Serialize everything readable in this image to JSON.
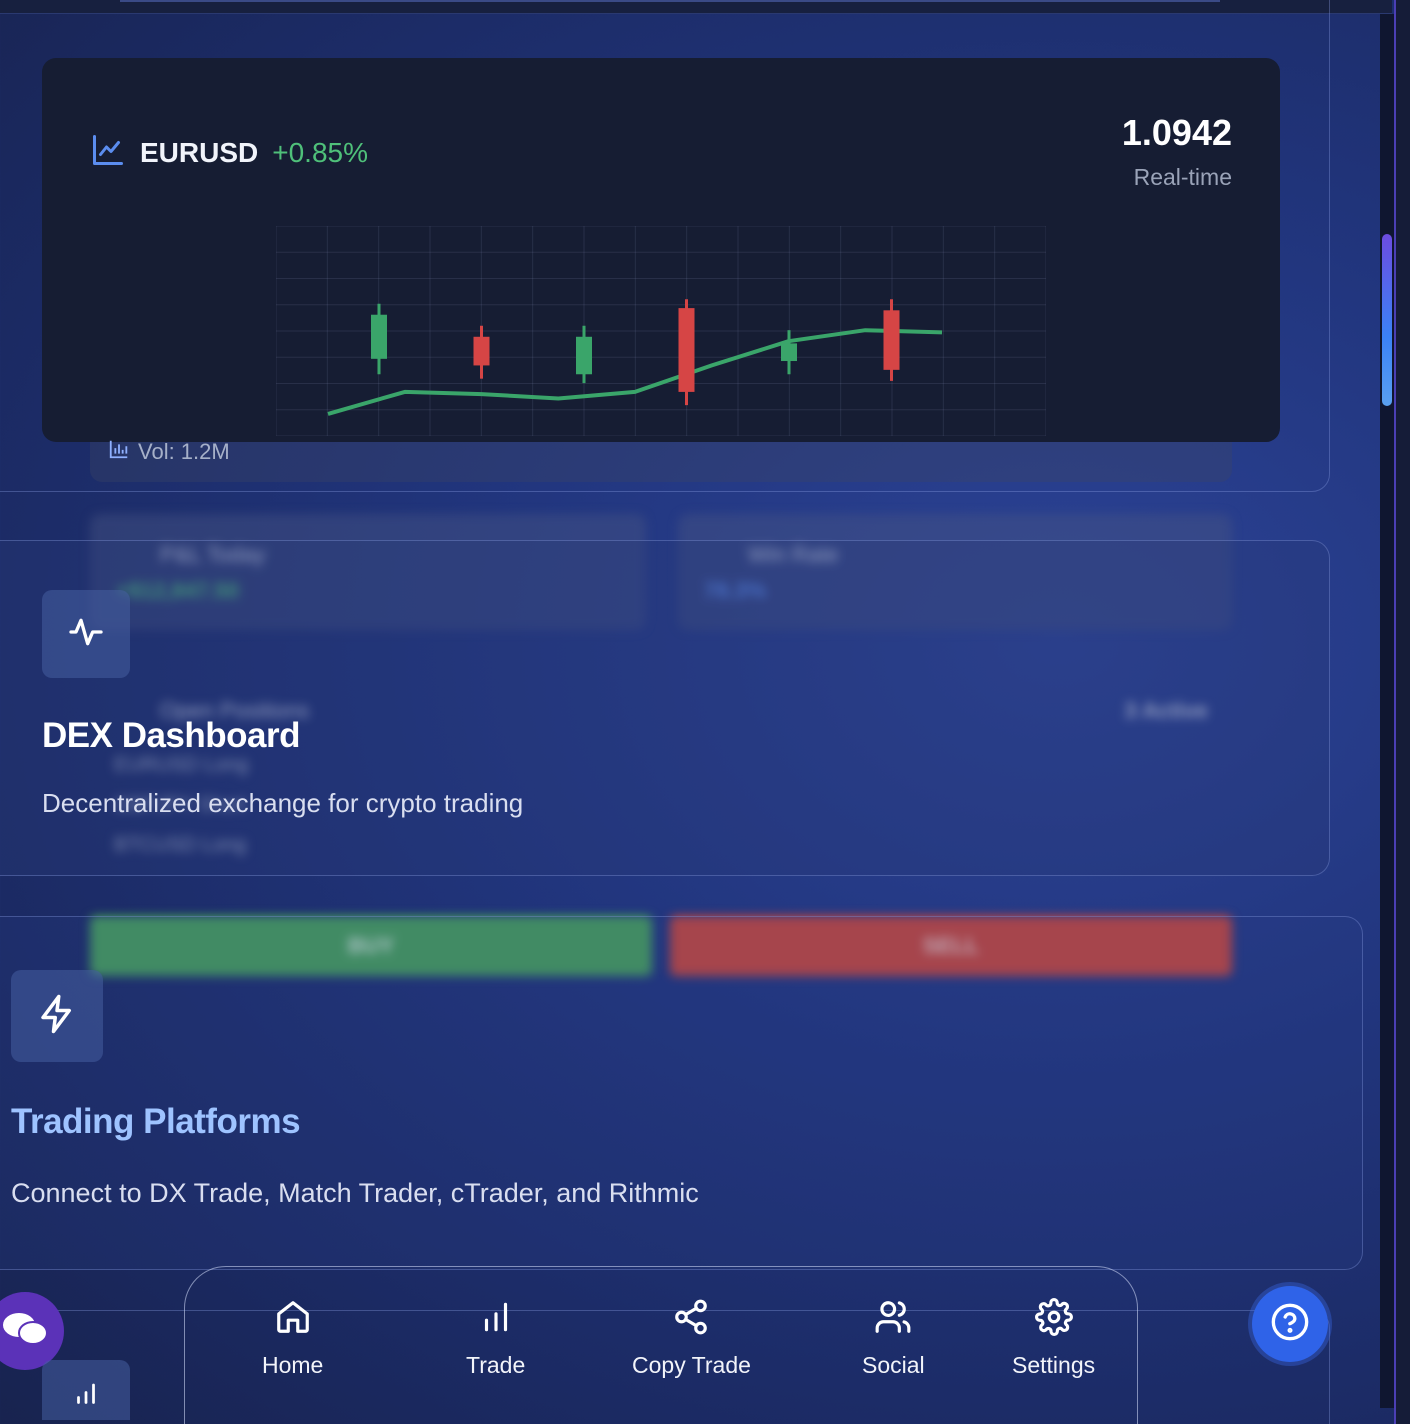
{
  "ticker": {
    "pair": "EURUSD",
    "change": "+0.85%",
    "price": "1.0942",
    "price_caption": "Real-time",
    "volume": "Vol: 1.2M"
  },
  "chart_data": {
    "type": "candlestick",
    "candles": [
      {
        "open": 0.35,
        "close": 0.55,
        "high": 0.6,
        "low": 0.28,
        "direction": "up"
      },
      {
        "open": 0.45,
        "close": 0.32,
        "high": 0.5,
        "low": 0.26,
        "direction": "down"
      },
      {
        "open": 0.28,
        "close": 0.45,
        "high": 0.5,
        "low": 0.24,
        "direction": "up"
      },
      {
        "open": 0.58,
        "close": 0.2,
        "high": 0.62,
        "low": 0.14,
        "direction": "down"
      },
      {
        "open": 0.34,
        "close": 0.42,
        "high": 0.48,
        "low": 0.28,
        "direction": "up"
      },
      {
        "open": 0.57,
        "close": 0.3,
        "high": 0.62,
        "low": 0.25,
        "direction": "down"
      }
    ],
    "trend_line": [
      0.1,
      0.2,
      0.19,
      0.17,
      0.2,
      0.32,
      0.43,
      0.48,
      0.47
    ],
    "colors": {
      "up": "#3aa56a",
      "down": "#d64545",
      "line": "#3aa56a"
    }
  },
  "background_blurred": {
    "pnl_label": "P&L Today",
    "pnl_value": "+$12,847.50",
    "win_label": "Win Rate",
    "win_value": "78.3%",
    "positions_label": "Open Positions",
    "positions_count": "3 Active",
    "positions": [
      "EURUSD Long",
      "GBPJPY Short",
      "BTCUSD Long"
    ],
    "buy_label": "BUY",
    "sell_label": "SELL"
  },
  "features": [
    {
      "title": "DEX Dashboard",
      "description": "Decentralized exchange for crypto trading",
      "icon": "activity-icon",
      "title_color": "#ffffff"
    },
    {
      "title": "Trading Platforms",
      "description": "Connect to DX Trade, Match Trader, cTrader, and Rithmic",
      "icon": "lightning-icon",
      "title_color": "#9ec3ff"
    }
  ],
  "nav": {
    "items": [
      {
        "label": "Home",
        "icon": "home-icon"
      },
      {
        "label": "Trade",
        "icon": "bar-chart-icon"
      },
      {
        "label": "Copy Trade",
        "icon": "share-icon"
      },
      {
        "label": "Social",
        "icon": "users-icon"
      },
      {
        "label": "Settings",
        "icon": "gear-icon"
      }
    ]
  },
  "colors": {
    "accent_green": "#4fc07a",
    "help_button": "#2f63e8",
    "chat_button": "#5b32b8"
  }
}
